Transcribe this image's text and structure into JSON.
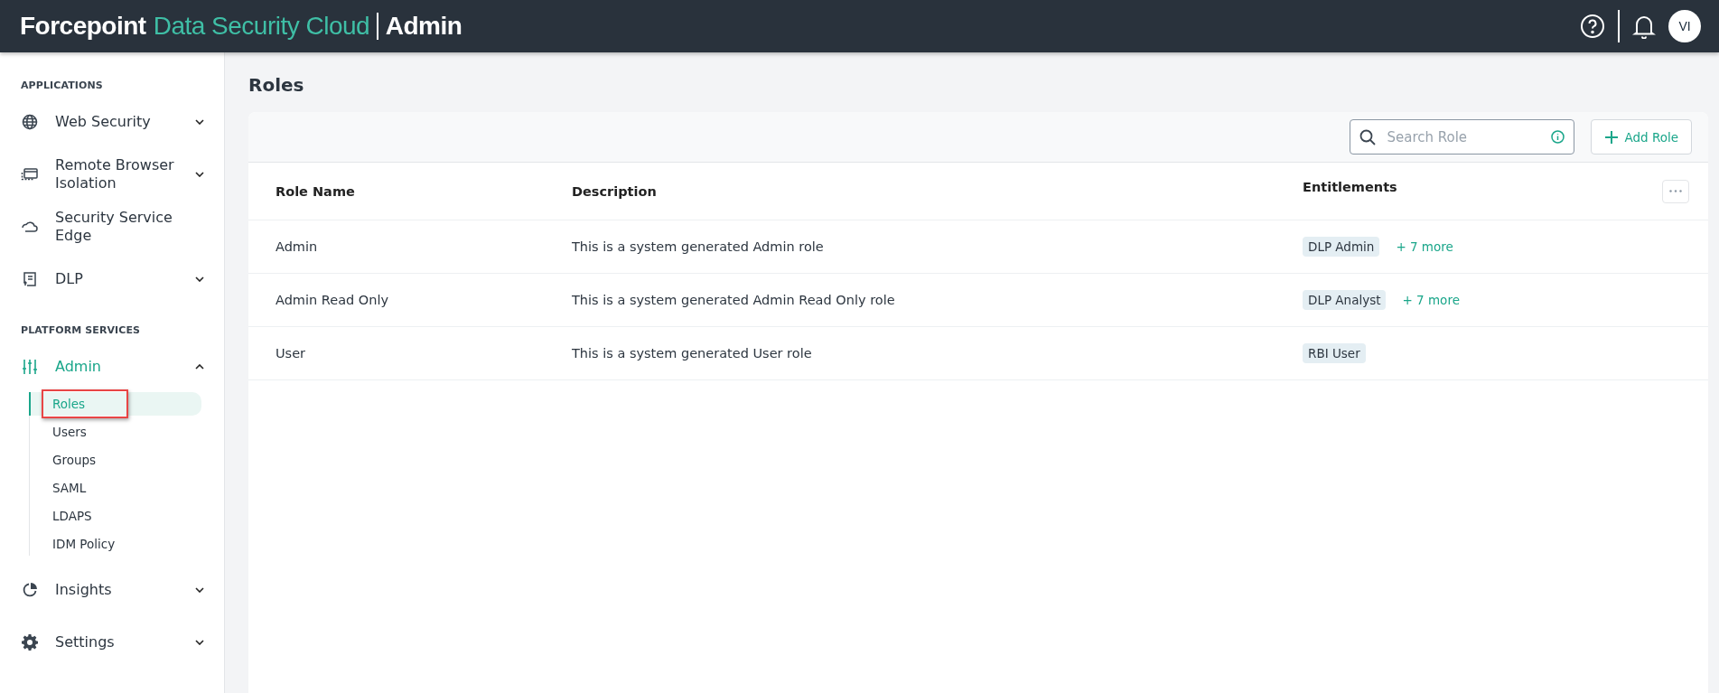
{
  "header": {
    "brand": "Forcepoint",
    "product": "Data Security Cloud",
    "section": "Admin",
    "avatar": "VI"
  },
  "sidebar": {
    "sections": [
      {
        "title": "APPLICATIONS",
        "items": [
          {
            "label": "Web Security",
            "kind": "group",
            "expanded": false,
            "selected": false
          },
          {
            "label": "Remote Browser Isolation",
            "kind": "group",
            "expanded": false,
            "selected": false
          },
          {
            "label": "Security Service Edge",
            "kind": "link",
            "selected": false
          },
          {
            "label": "DLP",
            "kind": "group",
            "expanded": false,
            "selected": false
          }
        ]
      },
      {
        "title": "PLATFORM SERVICES",
        "items": [
          {
            "label": "Admin",
            "kind": "group",
            "expanded": true,
            "selected": true,
            "children": [
              {
                "label": "Roles",
                "selected": true,
                "highlighted": true
              },
              {
                "label": "Users",
                "selected": false,
                "highlighted": false
              },
              {
                "label": "Groups",
                "selected": false,
                "highlighted": false
              },
              {
                "label": "SAML",
                "selected": false,
                "highlighted": false
              },
              {
                "label": "LDAPS",
                "selected": false,
                "highlighted": false
              },
              {
                "label": "IDM Policy",
                "selected": false,
                "highlighted": false
              }
            ]
          },
          {
            "label": "Insights",
            "kind": "group",
            "expanded": false,
            "selected": false
          },
          {
            "label": "Settings",
            "kind": "group",
            "expanded": false,
            "selected": false
          }
        ]
      }
    ]
  },
  "page": {
    "title": "Roles",
    "search": {
      "placeholder": "Search Role"
    },
    "add_button": "Add Role",
    "table": {
      "columns": [
        "Role Name",
        "Description",
        "Entitlements"
      ],
      "rows": [
        {
          "name": "Admin",
          "description": "This is a system generated Admin role",
          "entitlement": "DLP Admin",
          "more": "+ 7 more"
        },
        {
          "name": "Admin Read Only",
          "description": "This is a system generated Admin Read Only role",
          "entitlement": "DLP Analyst",
          "more": "+ 7 more"
        },
        {
          "name": "User",
          "description": "This is a system generated User role",
          "entitlement": "RBI User"
        }
      ]
    }
  }
}
